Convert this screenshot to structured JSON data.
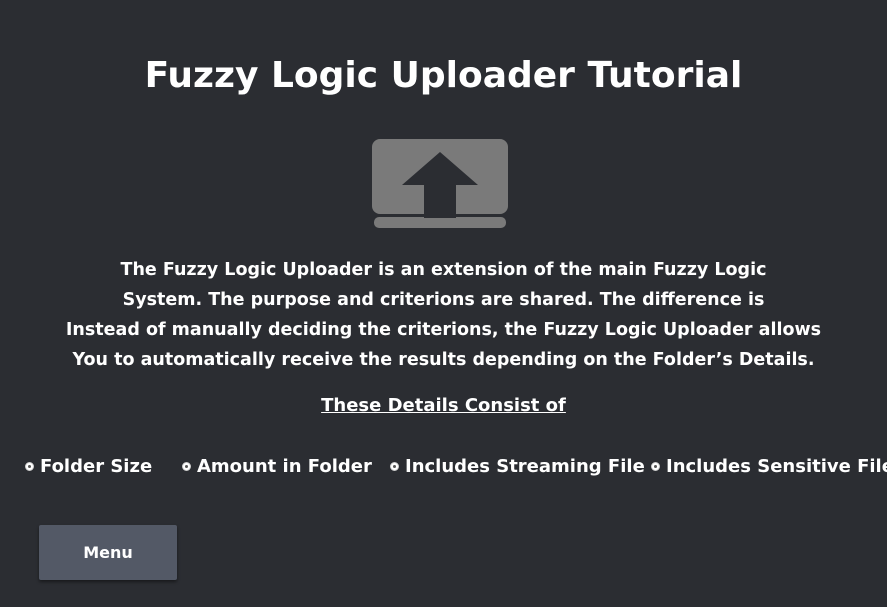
{
  "window": {
    "title": "Fuzzy Logic Uploader Tutorial"
  },
  "icon": {
    "name": "upload-icon",
    "color": "#7a7a7a"
  },
  "description": {
    "lines": [
      "The Fuzzy Logic Uploader is an extension of the main Fuzzy Logic",
      "System. The purpose and criterions are shared. The difference is",
      "Instead of manually deciding the criterions, the Fuzzy Logic Uploader allows",
      "You to automatically receive the results depending on the Folder’s Details."
    ]
  },
  "details": {
    "heading": "These Details Consist of",
    "items": [
      {
        "label": "Folder Size"
      },
      {
        "label": "Amount in Folder"
      },
      {
        "label": "Includes Streaming File"
      },
      {
        "label": "Includes Sensitive File"
      }
    ]
  },
  "menu_button": {
    "label": "Menu"
  },
  "colors": {
    "background": "#2b2d32",
    "button": "#535966",
    "text": "#ffffff"
  }
}
